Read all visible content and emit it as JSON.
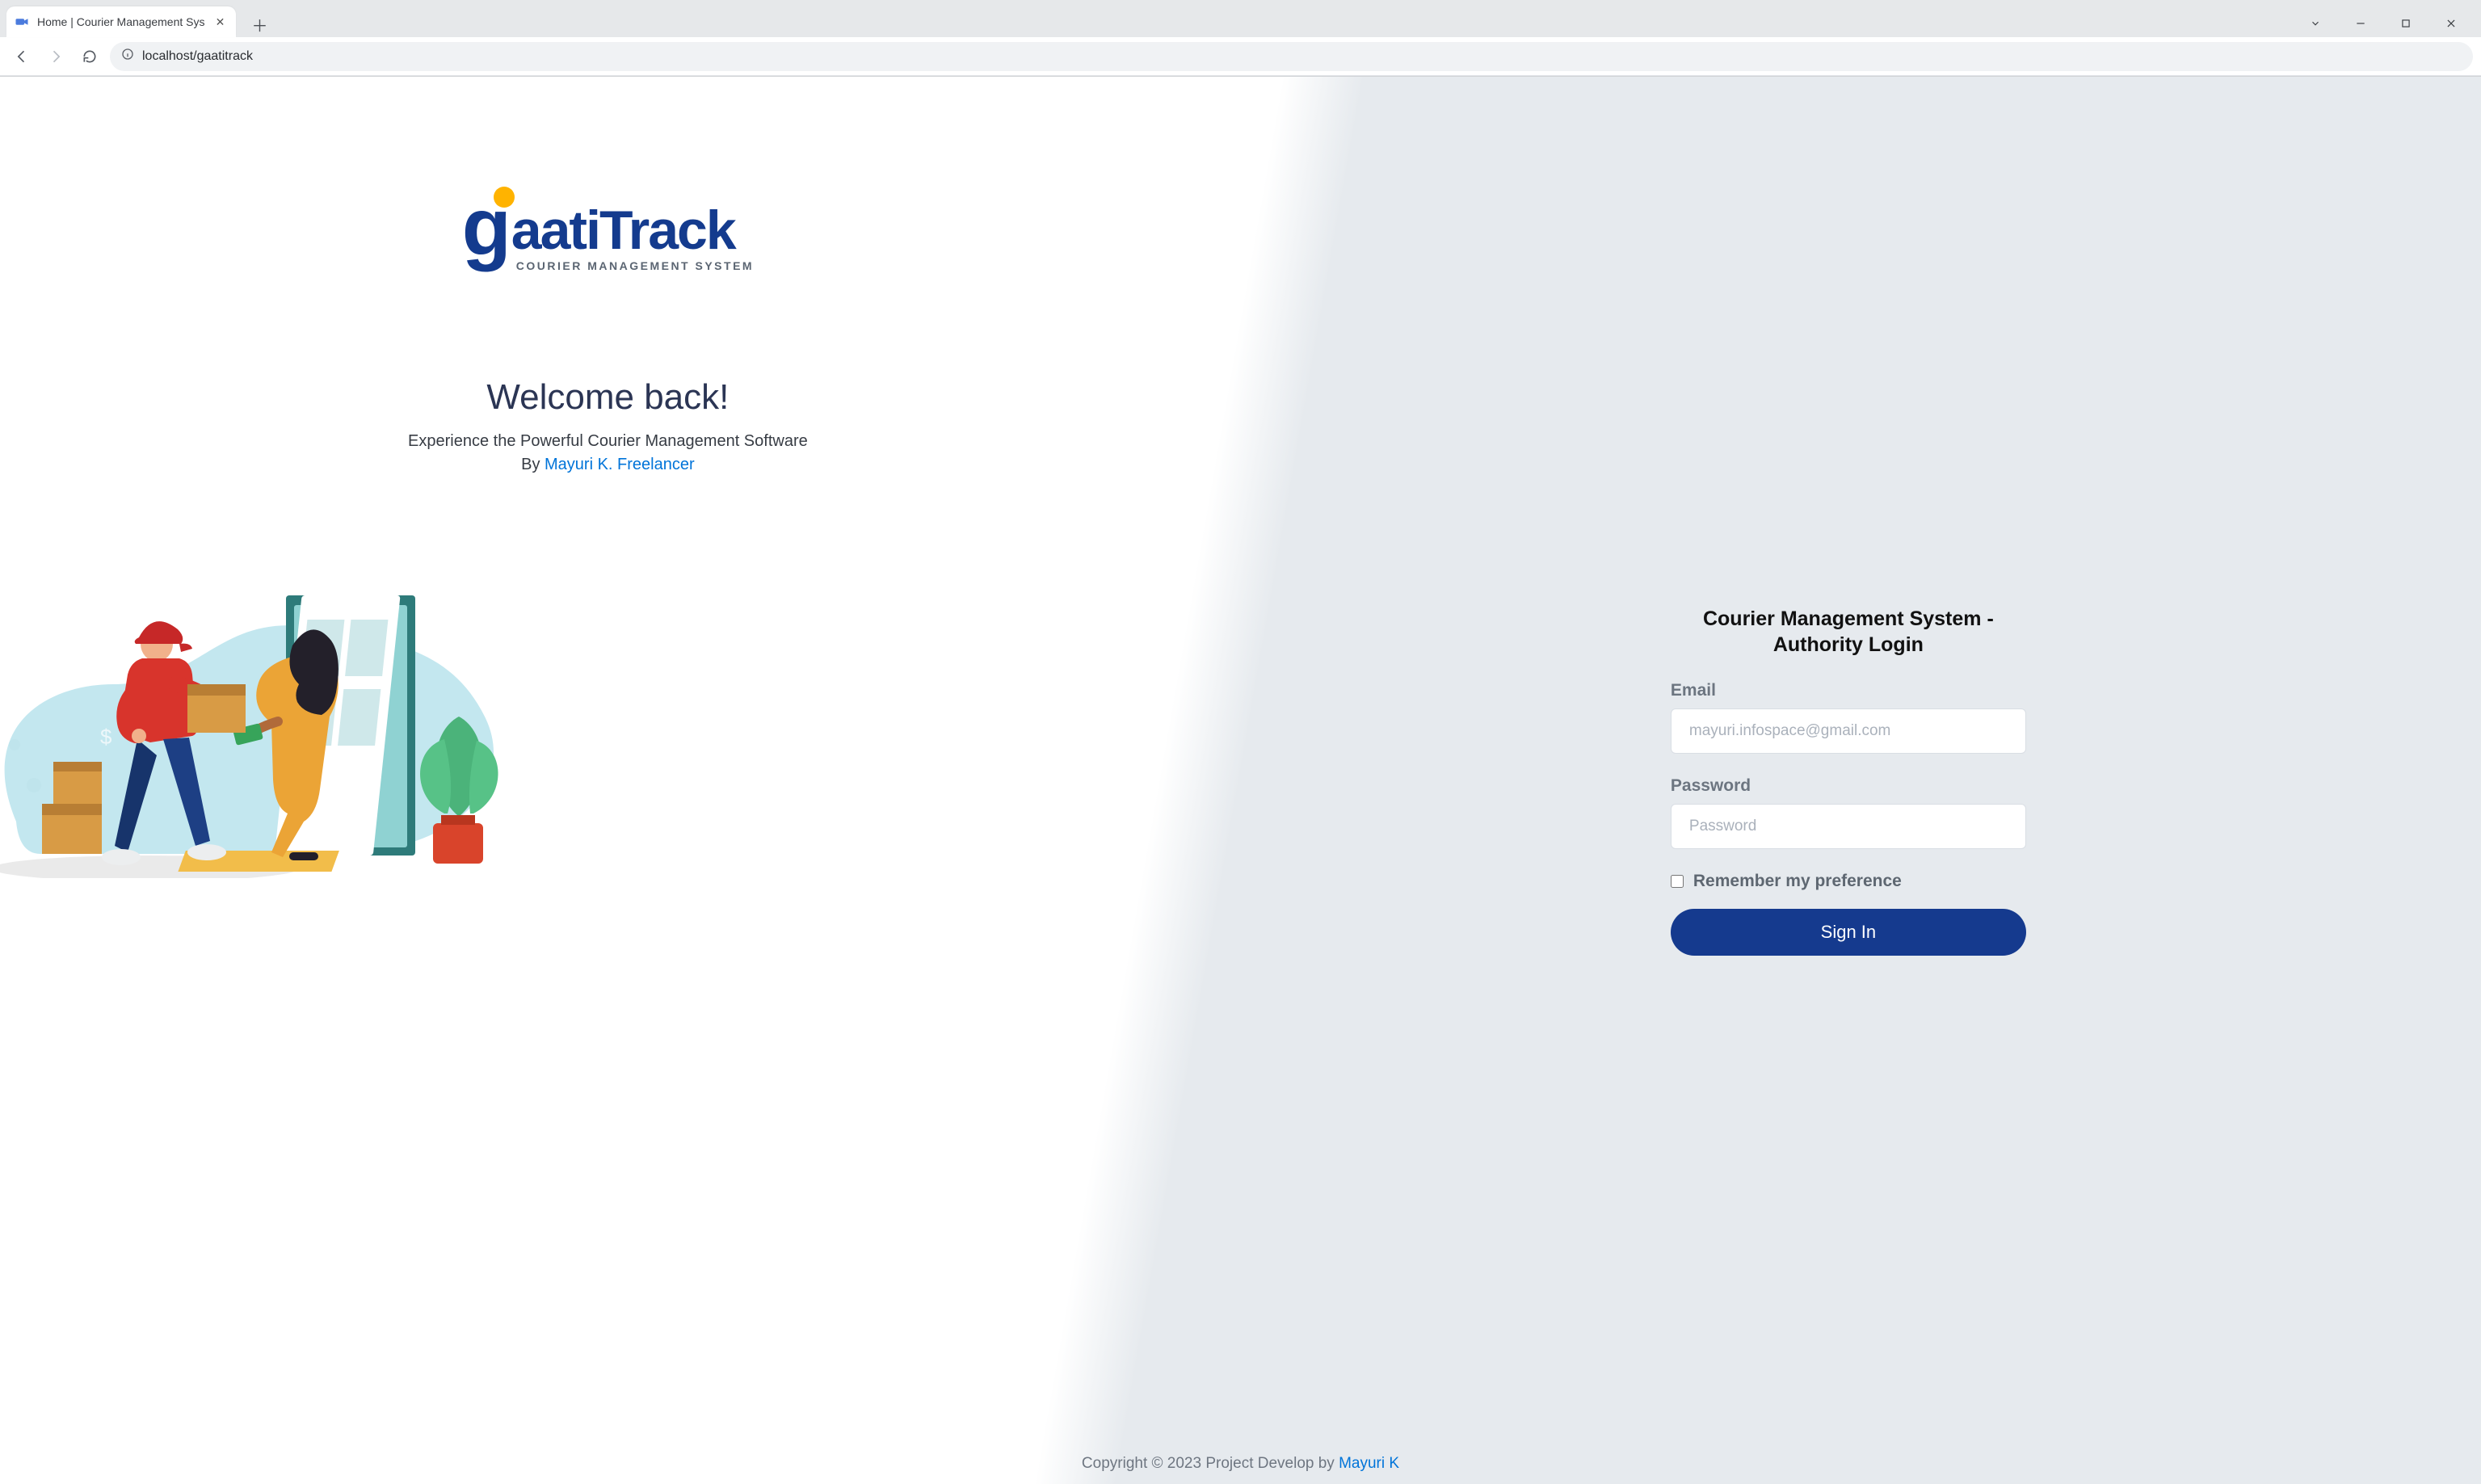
{
  "browser": {
    "tab_title": "Home | Courier Management Sys",
    "url": "localhost/gaatitrack"
  },
  "logo": {
    "brand_g": "g",
    "brand_rest": "aatiTrack",
    "tagline": "COURIER MANAGEMENT SYSTEM"
  },
  "welcome": {
    "heading": "Welcome back!",
    "subheading": "Experience the Powerful Courier Management Software",
    "by_prefix": "By ",
    "by_link": "Mayuri K. Freelancer"
  },
  "login": {
    "title_line1": "Courier Management System -",
    "title_line2": "Authority Login",
    "email_label": "Email",
    "email_placeholder": "mayuri.infospace@gmail.com",
    "password_label": "Password",
    "password_placeholder": "Password",
    "remember_label": "Remember my preference",
    "signin_label": "Sign In"
  },
  "footer": {
    "text": "Copyright © 2023 Project Develop by ",
    "link": "Mayuri K"
  }
}
